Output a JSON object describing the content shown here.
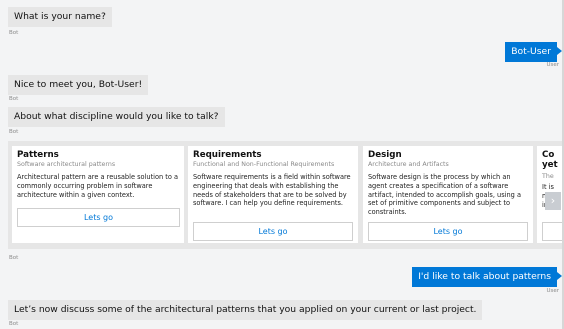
{
  "messages": [
    {
      "from": "bot",
      "text": "What is your name?",
      "sender": "Bot"
    },
    {
      "from": "user",
      "text": "Bot-User",
      "sender": "User"
    },
    {
      "from": "bot",
      "text": "Nice to meet you, Bot-User!",
      "sender": "Bot"
    },
    {
      "from": "bot",
      "text": "About what discipline would you like to talk?",
      "sender": "Bot"
    },
    {
      "from": "bot-carousel",
      "sender": "Bot"
    },
    {
      "from": "user",
      "text": "I'd like to talk about patterns",
      "sender": "User"
    },
    {
      "from": "bot",
      "text": "Let’s now discuss some of the architectural patterns that you applied on your current or last project.",
      "sender": "Bot"
    }
  ],
  "carousel": {
    "cards": [
      {
        "title": "Patterns",
        "subtitle": "Software architectural patterns",
        "text": "Architectural pattern are a reusable solution to a commonly occurring problem in software architecture within a given context.",
        "button": "Lets go"
      },
      {
        "title": "Requirements",
        "subtitle": "Functional and Non-Functional Requirements",
        "text": "Software requirements is a field within software engineering that deals with establishing the needs of stakeholders that are to be solved by software. I can help you define requirements.",
        "button": "Lets go"
      },
      {
        "title": "Design",
        "subtitle": "Architecture and Artifacts",
        "text": "Software design is the process by which an agent creates a specification of a software artifact, intended to accomplish goals, using a set of primitive components and subject to constraints.",
        "button": "Lets go"
      },
      {
        "title": "Co yet",
        "subtitle": "The",
        "text": "It is m of inte",
        "button": ""
      }
    ],
    "next_icon": "chevron-right-icon",
    "next_glyph": "›"
  },
  "colors": {
    "bot_bubble": "#e6e6e6",
    "user_bubble": "#0078d7",
    "background": "#f3f4f5",
    "link": "#0078d7"
  }
}
